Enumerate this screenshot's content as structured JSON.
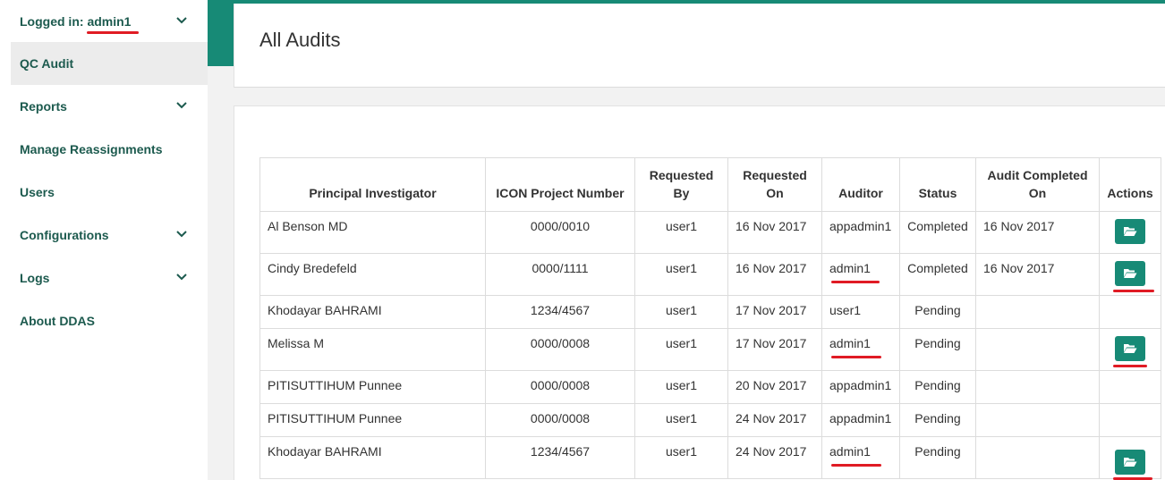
{
  "sidebar": {
    "logged_in_label": "Logged in:",
    "user": "admin1",
    "items": [
      {
        "label": "QC Audit",
        "has_chevron": false,
        "active": true
      },
      {
        "label": "Reports",
        "has_chevron": true
      },
      {
        "label": "Manage Reassignments",
        "has_chevron": false
      },
      {
        "label": "Users",
        "has_chevron": false
      },
      {
        "label": "Configurations",
        "has_chevron": true
      },
      {
        "label": "Logs",
        "has_chevron": true
      },
      {
        "label": "About DDAS",
        "has_chevron": false
      }
    ]
  },
  "header": {
    "title": "All Audits"
  },
  "table": {
    "columns": [
      "Principal Investigator",
      "ICON Project Number",
      "Requested By",
      "Requested On",
      "Auditor",
      "Status",
      "Audit Completed On",
      "Actions"
    ],
    "rows": [
      {
        "pi": "Al Benson MD",
        "project": "0000/0010",
        "requested_by": "user1",
        "requested_on": "16 Nov 2017",
        "auditor": "appadmin1",
        "status": "Completed",
        "completed_on": "16 Nov 2017",
        "action": true
      },
      {
        "pi": "Cindy Bredefeld",
        "project": "0000/1111",
        "requested_by": "user1",
        "requested_on": "16 Nov 2017",
        "auditor": "admin1",
        "status": "Completed",
        "completed_on": "16 Nov 2017",
        "action": true
      },
      {
        "pi": "Khodayar BAHRAMI",
        "project": "1234/4567",
        "requested_by": "user1",
        "requested_on": "17 Nov 2017",
        "auditor": "user1",
        "status": "Pending",
        "completed_on": "",
        "action": false
      },
      {
        "pi": "Melissa M",
        "project": "0000/0008",
        "requested_by": "user1",
        "requested_on": "17 Nov 2017",
        "auditor": "admin1",
        "status": "Pending",
        "completed_on": "",
        "action": true
      },
      {
        "pi": "PITISUTTIHUM Punnee",
        "project": "0000/0008",
        "requested_by": "user1",
        "requested_on": "20 Nov 2017",
        "auditor": "appadmin1",
        "status": "Pending",
        "completed_on": "",
        "action": false
      },
      {
        "pi": "PITISUTTIHUM Punnee",
        "project": "0000/0008",
        "requested_by": "user1",
        "requested_on": "24 Nov 2017",
        "auditor": "appadmin1",
        "status": "Pending",
        "completed_on": "",
        "action": false
      },
      {
        "pi": "Khodayar BAHRAMI",
        "project": "1234/4567",
        "requested_by": "user1",
        "requested_on": "24 Nov 2017",
        "auditor": "admin1",
        "status": "Pending",
        "completed_on": "",
        "action": true
      }
    ]
  },
  "icons": {
    "action": "folder-open-icon",
    "expand": "chevron-down-icon"
  },
  "colors": {
    "brand": "#178a76",
    "nav_text": "#1c5a4e",
    "annotation": "#e01b24"
  }
}
